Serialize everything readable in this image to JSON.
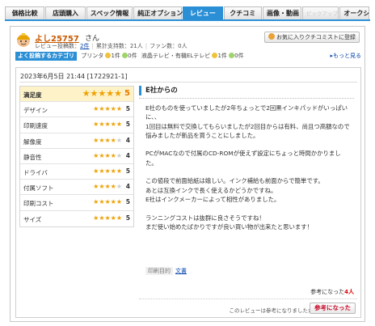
{
  "tabs": [
    {
      "label": "価格比較"
    },
    {
      "label": "店頭購入"
    },
    {
      "label": "スペック情報"
    },
    {
      "label": "純正オプション"
    },
    {
      "label": "レビュー"
    },
    {
      "label": "クチコミ"
    },
    {
      "label": "画像・動画"
    },
    {
      "label": "ピックアップリスト"
    },
    {
      "label": "オークション"
    }
  ],
  "user": {
    "name": "よし25757",
    "honorific": "さん",
    "review_count_label": "レビュー投稿数：",
    "review_count": "2件",
    "votes_label": "累計支持数：",
    "votes": "21人",
    "fans_label": "ファン数：",
    "fans": "0人",
    "favorite_button": "お気に入りクチコミストに登録"
  },
  "categories": {
    "tag": "よく投稿するカテゴリ",
    "items": [
      {
        "name": "プリンタ",
        "count": "1件",
        "count2": "0件"
      },
      {
        "name": "液晶テレビ・有機ELテレビ",
        "count": "1件",
        "count2": "0件"
      }
    ],
    "more": "▸もっと見る"
  },
  "review": {
    "date": "2023年6月5日 21:44 [1722921-1]",
    "title": "E社からの",
    "scores": [
      {
        "label": "満足度",
        "value": 5
      },
      {
        "label": "デザイン",
        "value": 5
      },
      {
        "label": "印刷速度",
        "value": 5
      },
      {
        "label": "解像度",
        "value": 4
      },
      {
        "label": "静音性",
        "value": 4
      },
      {
        "label": "ドライバ",
        "value": 5
      },
      {
        "label": "付属ソフト",
        "value": 4
      },
      {
        "label": "印刷コスト",
        "value": 5
      },
      {
        "label": "サイズ",
        "value": 5
      }
    ],
    "body": [
      "E社のものを使っていましたが2年ちょっとで2回黒インキパッドがいっぱい",
      "に、、",
      "1回目は無料で交換してもらいましたが2回目からは有料、尚且つ高額なので",
      "悩みましたが新品を買うことにしました。",
      "",
      "PCがMACなので付属のCD-ROMが使えず設定にちょっと時間かかりまし",
      "た。",
      "",
      "この値段で前面給紙は嬉しい。インク補給も前面からで簡単です。",
      "あとは互換インクで長く使えるかどうかですね。",
      "E社はインクメーカーによって相性がありました。",
      "",
      "ランニングコストは抜群に良さそうですね！",
      "まだ使い始めたばかりですが良い買い物が出来たと思います！"
    ],
    "purpose_label": "印刷目的",
    "purpose_value": "文書",
    "helpful_prefix": "参考になった",
    "helpful_count": "4人",
    "question": "このレビューは参考になりましたか？",
    "vote_button": "参考になった"
  },
  "colors": {
    "accent": "#2b8fd6",
    "star": "#f0a000",
    "highlight": "#fdf2c8"
  }
}
